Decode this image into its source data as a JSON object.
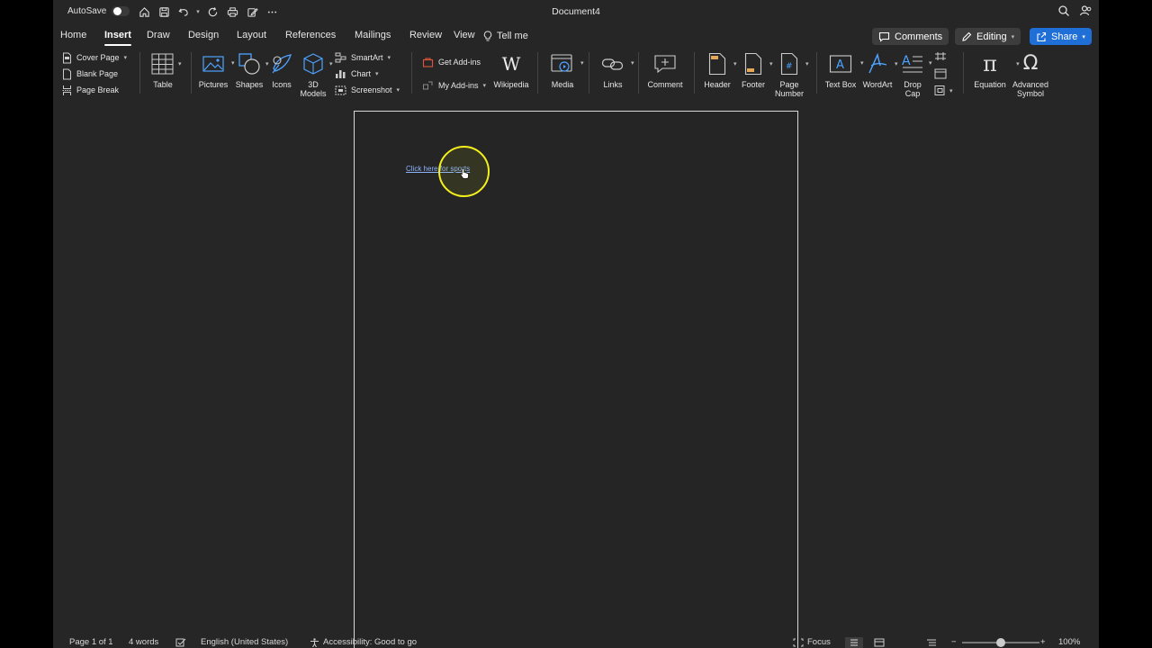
{
  "window": {
    "autosave_label": "AutoSave",
    "title": "Document4"
  },
  "tabs": [
    {
      "label": "Home"
    },
    {
      "label": "Insert"
    },
    {
      "label": "Draw"
    },
    {
      "label": "Design"
    },
    {
      "label": "Layout"
    },
    {
      "label": "References"
    },
    {
      "label": "Mailings"
    },
    {
      "label": "Review"
    },
    {
      "label": "View"
    }
  ],
  "tell_me": "Tell me",
  "header_buttons": {
    "comments": "Comments",
    "editing": "Editing",
    "share": "Share"
  },
  "ribbon": {
    "pages": [
      "Cover Page",
      "Blank Page",
      "Page Break"
    ],
    "table": "Table",
    "pictures": "Pictures",
    "shapes": "Shapes",
    "icons": "Icons",
    "models3d": "3D\nModels",
    "smartart": "SmartArt",
    "chart": "Chart",
    "screenshot": "Screenshot",
    "get_addins": "Get Add-ins",
    "my_addins": "My Add-ins",
    "wikipedia": "Wikipedia",
    "media": "Media",
    "links": "Links",
    "comment": "Comment",
    "header": "Header",
    "footer": "Footer",
    "page_number": "Page\nNumber",
    "text_box": "Text Box",
    "wordart": "WordArt",
    "drop_cap": "Drop\nCap",
    "equation": "Equation",
    "advanced_symbol": "Advanced\nSymbol"
  },
  "document": {
    "link_text": "Click here for sports"
  },
  "status": {
    "page": "Page 1 of 1",
    "words": "4 words",
    "language": "English (United States)",
    "accessibility": "Accessibility: Good to go",
    "focus": "Focus",
    "zoom": "100%",
    "zoom_level": 1.0
  },
  "colors": {
    "accent": "#1f6fd6",
    "link": "#8cb4ff",
    "highlight": "#f4f01d",
    "icon_blue": "#4da3ff"
  }
}
